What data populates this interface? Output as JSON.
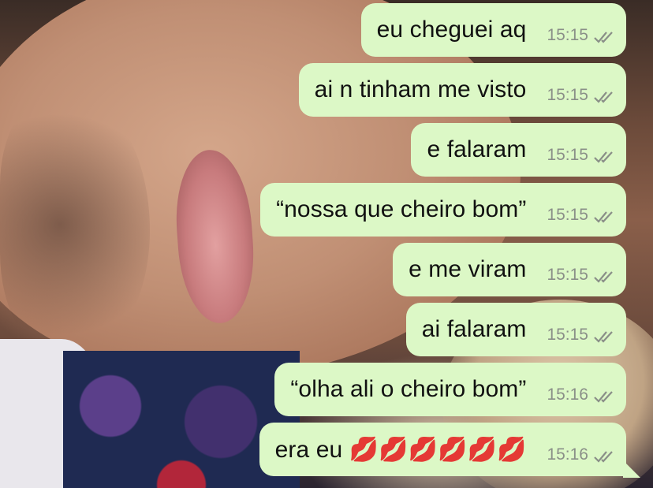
{
  "messages": [
    {
      "text": "eu cheguei aq",
      "time": "15:15",
      "status": "read-double-check-icon"
    },
    {
      "text": "ai n tinham me visto",
      "time": "15:15",
      "status": "read-double-check-icon"
    },
    {
      "text": "e falaram",
      "time": "15:15",
      "status": "read-double-check-icon"
    },
    {
      "text": "“nossa que cheiro bom”",
      "time": "15:15",
      "status": "read-double-check-icon"
    },
    {
      "text": "e me viram",
      "time": "15:15",
      "status": "read-double-check-icon"
    },
    {
      "text": "ai falaram",
      "time": "15:15",
      "status": "read-double-check-icon"
    },
    {
      "text": "“olha ali o cheiro bom”",
      "time": "15:16",
      "status": "read-double-check-icon"
    },
    {
      "text": "era eu 💋💋💋💋💋💋",
      "time": "15:16",
      "status": "read-double-check-icon"
    }
  ],
  "colors": {
    "bubble_outgoing": "#dcf8c6",
    "timestamp": "#8a8f88",
    "text": "#111111"
  }
}
